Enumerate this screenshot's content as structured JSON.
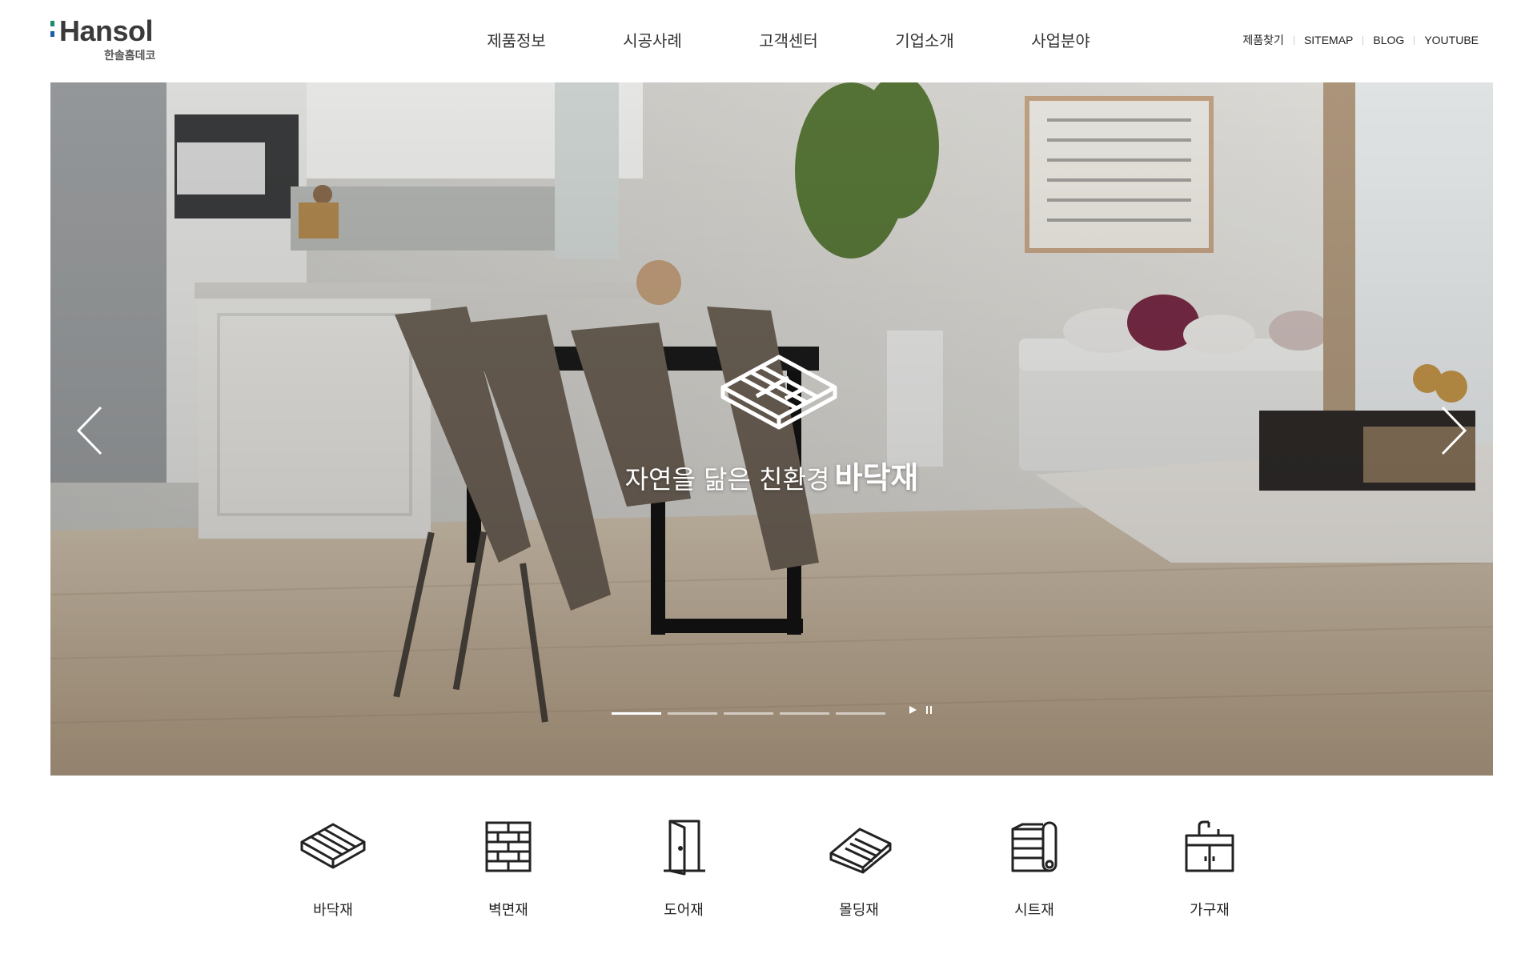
{
  "brand": {
    "name": "Hansol",
    "sub": "한솔홈데코",
    "mark_colors": [
      "#1d8c6e",
      "#1a5fa8"
    ]
  },
  "nav": {
    "items": [
      {
        "label": "제품정보"
      },
      {
        "label": "시공사례"
      },
      {
        "label": "고객센터"
      },
      {
        "label": "기업소개"
      },
      {
        "label": "사업분야"
      }
    ]
  },
  "util": {
    "items": [
      {
        "label": "제품찾기"
      },
      {
        "label": "SITEMAP"
      },
      {
        "label": "BLOG"
      },
      {
        "label": "YOUTUBE"
      }
    ]
  },
  "hero": {
    "caption": "자연을 닮은 친환경",
    "caption_bold": "바닥재",
    "slide_count": 5,
    "active_slide": 1,
    "icon": "flooring-icon",
    "controls": [
      "play-icon",
      "pause-icon"
    ]
  },
  "categories": [
    {
      "label": "바닥재",
      "icon": "flooring-icon"
    },
    {
      "label": "벽면재",
      "icon": "wall-panel-icon"
    },
    {
      "label": "도어재",
      "icon": "door-icon"
    },
    {
      "label": "몰딩재",
      "icon": "molding-icon"
    },
    {
      "label": "시트재",
      "icon": "sheet-roll-icon"
    },
    {
      "label": "가구재",
      "icon": "cabinet-icon"
    }
  ]
}
